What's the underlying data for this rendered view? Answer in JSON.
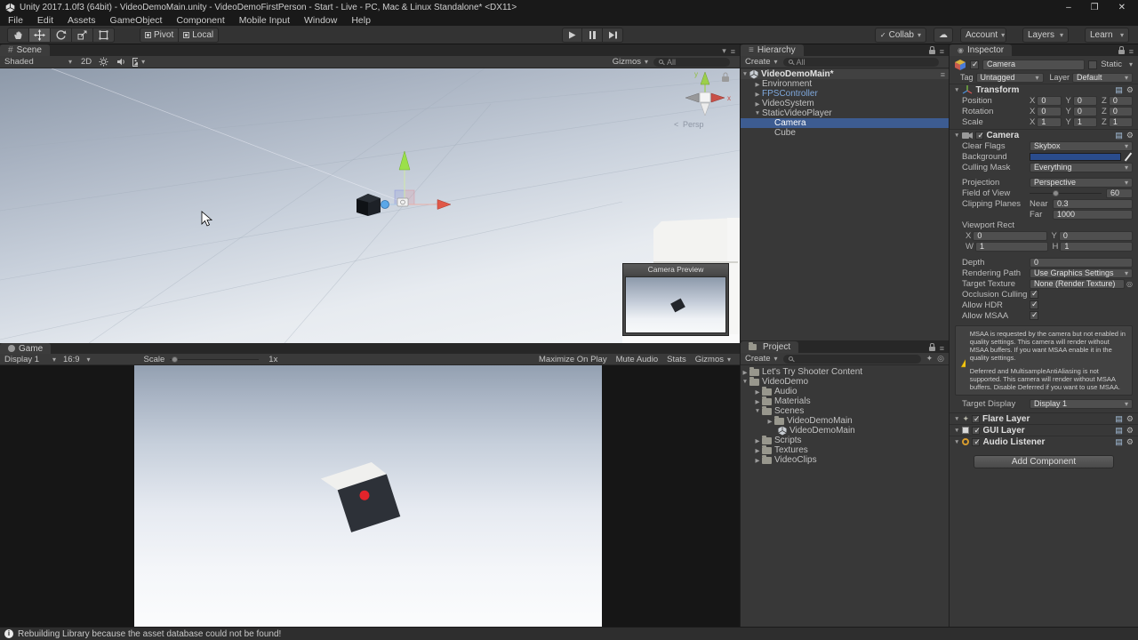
{
  "icons": {
    "collapsed": "▶",
    "expanded": "▼",
    "dropdown": "▾",
    "menu": "≡",
    "check": "✓",
    "cloud": "☁",
    "gear": "⚙",
    "book": "▤",
    "star": "✦",
    "target": "◎",
    "info": "i",
    "persp_arrow": "<",
    "scene_tab": "#",
    "inspector_tab": "◉",
    "minimize": "–",
    "maximize": "❐",
    "close": "✕",
    "picker": "◎"
  },
  "window": {
    "title": "Unity 2017.1.0f3 (64bit) - VideoDemoMain.unity - VideoDemoFirstPerson - Start - Live - PC, Mac & Linux Standalone* <DX11>"
  },
  "menu": {
    "items": [
      "File",
      "Edit",
      "Assets",
      "GameObject",
      "Component",
      "Mobile Input",
      "Window",
      "Help"
    ]
  },
  "toolbar": {
    "pivot": "Pivot",
    "local": "Local",
    "collab": "Collab",
    "account": "Account",
    "layers": "Layers",
    "learn": "Learn"
  },
  "scene_panel": {
    "tab": "Scene",
    "shading": "Shaded",
    "mode_2d": "2D",
    "gizmos": "Gizmos",
    "search": "All",
    "persp": "Persp",
    "axis_x": "x",
    "axis_y": "y",
    "camera_preview": "Camera Preview"
  },
  "game_panel": {
    "tab": "Game",
    "display": "Display 1",
    "aspect": "16:9",
    "scale_label": "Scale",
    "scale_value": "1x",
    "maximize_on_play": "Maximize On Play",
    "mute_audio": "Mute Audio",
    "stats": "Stats",
    "gizmos": "Gizmos"
  },
  "hierarchy": {
    "tab": "Hierarchy",
    "create": "Create",
    "search": "All",
    "items": [
      {
        "label": "VideoDemoMain*"
      },
      {
        "label": "Environment"
      },
      {
        "label": "FPSController"
      },
      {
        "label": "VideoSystem"
      },
      {
        "label": "StaticVideoPlayer"
      },
      {
        "label": "Camera"
      },
      {
        "label": "Cube"
      }
    ]
  },
  "project": {
    "tab": "Project",
    "create": "Create",
    "items": [
      {
        "label": "Let's Try Shooter Content"
      },
      {
        "label": "VideoDemo"
      },
      {
        "label": "Audio"
      },
      {
        "label": "Materials"
      },
      {
        "label": "Scenes"
      },
      {
        "label": "VideoDemoMain"
      },
      {
        "label": "VideoDemoMain"
      },
      {
        "label": "Scripts"
      },
      {
        "label": "Textures"
      },
      {
        "label": "VideoClips"
      }
    ]
  },
  "inspector": {
    "tab": "Inspector",
    "header": {
      "name": "Camera",
      "static": "Static",
      "tag_label": "Tag",
      "tag": "Untagged",
      "layer_label": "Layer",
      "layer": "Default"
    },
    "transform": {
      "title": "Transform",
      "x": "X",
      "y": "Y",
      "z": "Z",
      "rows": [
        {
          "label": "Position",
          "x": "0",
          "y": "0",
          "z": "0"
        },
        {
          "label": "Rotation",
          "x": "0",
          "y": "0",
          "z": "0"
        },
        {
          "label": "Scale",
          "x": "1",
          "y": "1",
          "z": "1"
        }
      ]
    },
    "camera": {
      "title": "Camera",
      "clear_flags_label": "Clear Flags",
      "clear_flags": "Skybox",
      "background_label": "Background",
      "background_color": "#2a4c8c",
      "culling_mask_label": "Culling Mask",
      "culling_mask": "Everything",
      "projection_label": "Projection",
      "projection": "Perspective",
      "fov_label": "Field of View",
      "fov": "60",
      "clipping_label": "Clipping Planes",
      "near_label": "Near",
      "near": "0.3",
      "far_label": "Far",
      "far": "1000",
      "viewport_label": "Viewport Rect",
      "x_label": "X",
      "x": "0",
      "y_label": "Y",
      "y": "0",
      "w_label": "W",
      "w": "1",
      "h_label": "H",
      "h": "1",
      "depth_label": "Depth",
      "depth": "0",
      "rendering_path_label": "Rendering Path",
      "rendering_path": "Use Graphics Settings",
      "target_texture_label": "Target Texture",
      "target_texture": "None (Render Texture)",
      "occlusion_label": "Occlusion Culling",
      "hdr_label": "Allow HDR",
      "msaa_label": "Allow MSAA",
      "warning1": "MSAA is requested by the camera but not enabled in quality settings. This camera will render without MSAA buffers. If you want MSAA enable it in the quality settings.",
      "warning2": "Deferred and MultisampleAntiAliasing is not supported. This camera will render without MSAA buffers. Disable Deferred if you want to use MSAA.",
      "target_display_label": "Target Display",
      "target_display": "Display 1"
    },
    "components": [
      {
        "title": "Flare Layer"
      },
      {
        "title": "GUI Layer"
      },
      {
        "title": "Audio Listener"
      }
    ],
    "add_component": "Add Component"
  },
  "status": {
    "message": "Rebuilding Library because the asset database could not be found!"
  }
}
